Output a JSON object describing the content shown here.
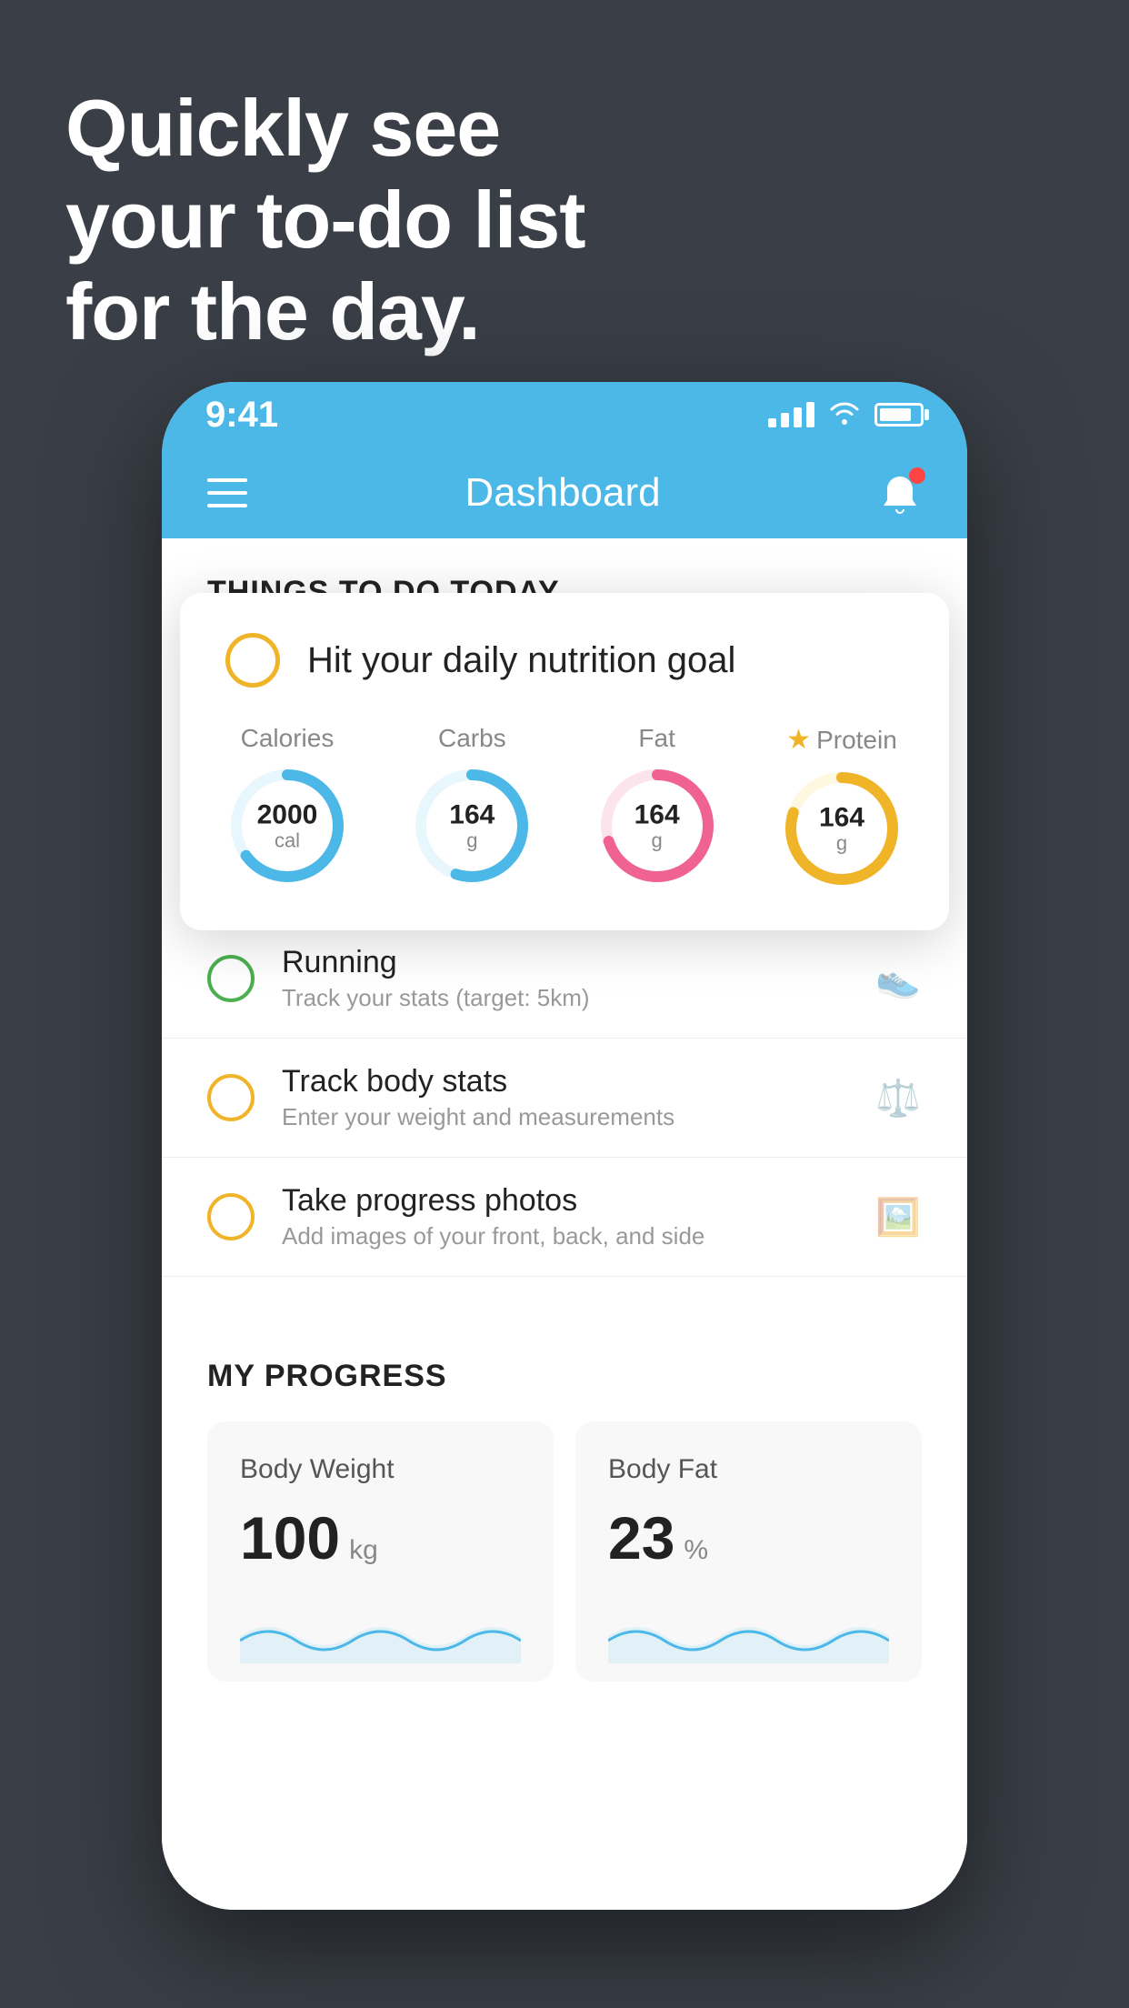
{
  "hero": {
    "line1": "Quickly see",
    "line2": "your to-do list",
    "line3": "for the day."
  },
  "status_bar": {
    "time": "9:41"
  },
  "nav": {
    "title": "Dashboard"
  },
  "things_header": "THINGS TO DO TODAY",
  "nutrition_card": {
    "title": "Hit your daily nutrition goal",
    "items": [
      {
        "label": "Calories",
        "value": "2000",
        "unit": "cal",
        "color": "#4cb8e8",
        "track_color": "#e8f7fd",
        "percent": 65
      },
      {
        "label": "Carbs",
        "value": "164",
        "unit": "g",
        "color": "#4cb8e8",
        "track_color": "#e8f7fd",
        "percent": 55
      },
      {
        "label": "Fat",
        "value": "164",
        "unit": "g",
        "color": "#f06292",
        "track_color": "#fce4ec",
        "percent": 70
      },
      {
        "label": "Protein",
        "value": "164",
        "unit": "g",
        "color": "#f0b429",
        "track_color": "#fff8e1",
        "percent": 80,
        "starred": true
      }
    ]
  },
  "todo_items": [
    {
      "id": 1,
      "title": "Running",
      "subtitle": "Track your stats (target: 5km)",
      "circle_color": "green",
      "icon": "👟"
    },
    {
      "id": 2,
      "title": "Track body stats",
      "subtitle": "Enter your weight and measurements",
      "circle_color": "yellow",
      "icon": "⚖️"
    },
    {
      "id": 3,
      "title": "Take progress photos",
      "subtitle": "Add images of your front, back, and side",
      "circle_color": "yellow",
      "icon": "🖼️"
    }
  ],
  "progress": {
    "title": "MY PROGRESS",
    "cards": [
      {
        "title": "Body Weight",
        "value": "100",
        "unit": "kg"
      },
      {
        "title": "Body Fat",
        "value": "23",
        "unit": "%"
      }
    ]
  }
}
